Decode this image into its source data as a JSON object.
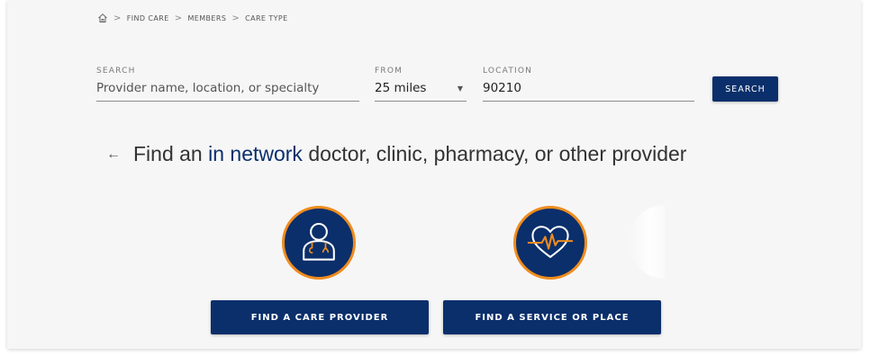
{
  "breadcrumb": {
    "home_icon": "home-icon",
    "items": [
      "FIND CARE",
      "MEMBERS",
      "CARE TYPE"
    ],
    "separator": ">"
  },
  "search": {
    "label": "SEARCH",
    "placeholder": "Provider name, location, or specialty",
    "value": ""
  },
  "from": {
    "label": "FROM",
    "value": "25 miles"
  },
  "location": {
    "label": "LOCATION",
    "value": "90210"
  },
  "search_button": "SEARCH",
  "headline": {
    "prefix": "Find an ",
    "highlight": "in network",
    "suffix": " doctor, clinic, pharmacy, or other provider"
  },
  "cards": [
    {
      "icon": "doctor-icon",
      "button": "FIND A CARE PROVIDER"
    },
    {
      "icon": "heartbeat-icon",
      "button": "FIND A SERVICE OR PLACE"
    }
  ],
  "colors": {
    "primary": "#0b2f6b",
    "accent": "#f08c1e",
    "background": "#f6f6f6"
  }
}
